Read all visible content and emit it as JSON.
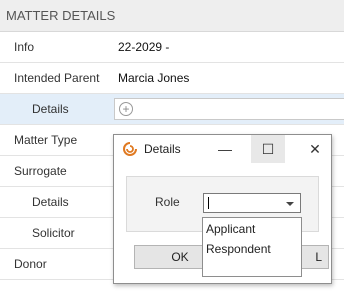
{
  "header": {
    "title": "MATTER DETAILS"
  },
  "rows": [
    {
      "label": "Info",
      "value": "22-2029 -"
    },
    {
      "label": "Intended Parent",
      "value": "Marcia Jones"
    },
    {
      "label": "Details",
      "add_icon": "plus-circle-icon"
    },
    {
      "label": "Matter Type"
    },
    {
      "label": "Surrogate"
    },
    {
      "label": "Details"
    },
    {
      "label": "Solicitor"
    },
    {
      "label": "Donor"
    }
  ],
  "dialog": {
    "title": "Details",
    "app_icon": "app-swirl-icon",
    "minimize_icon": "minimize-icon",
    "maximize_icon": "maximize-icon",
    "close_icon": "close-icon",
    "role_label": "Role",
    "role_value": "",
    "role_options": [
      "Applicant",
      "Respondent"
    ],
    "ok_label": "OK",
    "cancel_label": "L"
  },
  "colors": {
    "accent": "#e07a22",
    "selected_row": "#e3eef9"
  }
}
